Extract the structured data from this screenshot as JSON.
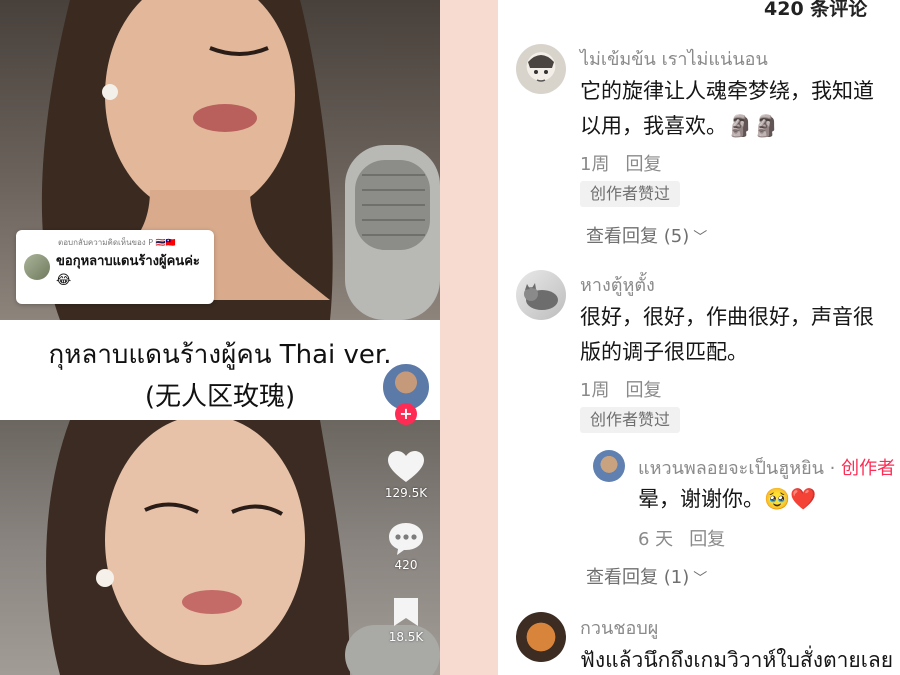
{
  "video": {
    "sticker_small": "ตอบกลับความคิดเห็นของ P 🇹🇭🇹🇼",
    "sticker_text": "ขอกุหลาบแดนร้างผู้คนค่ะ😂",
    "caption_line1": "กุหลาบแดนร้างผู้คน Thai ver.",
    "caption_line2": "(无人区玫瑰)",
    "follow_plus": "+",
    "likes": "129.5K",
    "comments": "420",
    "saves": "18.5K"
  },
  "comments_panel": {
    "header_count": "420 条评论",
    "items": [
      {
        "username": "ไม่เข้มข้น เราไม่แน่นอน",
        "text_line1": "它的旋律让人魂牵梦绕，我知道",
        "text_line2": "以用，我喜欢。🗿🗿",
        "time": "1周",
        "reply": "回复",
        "liked": "创作者赞过",
        "view_replies": "查看回复 (5)"
      },
      {
        "username": "หางตู้หูตั้ง",
        "text_line1": "很好，很好，作曲很好，声音很",
        "text_line2": "版的调子很匹配。",
        "time": "1周",
        "reply": "回复",
        "liked": "创作者赞过"
      }
    ],
    "nested_reply": {
      "username": "แหวนพลอยจะเป็นฮูหยิน",
      "dot": " · ",
      "creator_tag": "创作者",
      "text": "晕，谢谢你。🥹❤️",
      "time": "6 天",
      "reply": "回复"
    },
    "view_replies_2": "查看回复 (1)",
    "third": {
      "username": "กวนชอบผู",
      "text": "ฟังแล้วนึกถึงเกมวิวาห์ใบสั่งตายเลย"
    }
  },
  "colors": {
    "divider": "#f7dbd0",
    "accent_red": "#fe2c55",
    "muted_text": "#8a8a8a"
  }
}
